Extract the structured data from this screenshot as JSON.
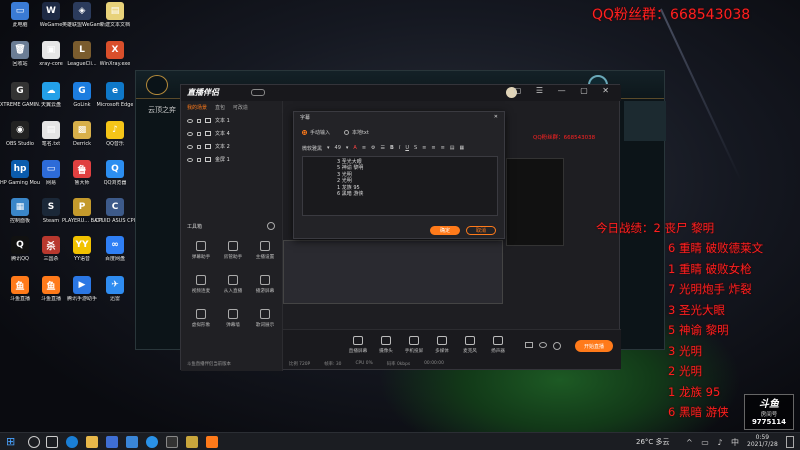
{
  "desktop_icons": [
    {
      "label": "此电脑",
      "color": "#3a7bd5",
      "glyph": "▭"
    },
    {
      "label": "WeGame",
      "color": "#1e2a44",
      "glyph": "W"
    },
    {
      "label": "英雄联盟WeGame版",
      "color": "#2b3b5c",
      "glyph": "◈"
    },
    {
      "label": "新建文本文档",
      "color": "#e8d27a",
      "glyph": "▤"
    },
    {
      "label": "回收站",
      "color": "#6b7d95",
      "glyph": "🗑"
    },
    {
      "label": "xray-core",
      "color": "#e6e6e6",
      "glyph": "▣"
    },
    {
      "label": "LeagueCli...",
      "color": "#7a5c2e",
      "glyph": "L"
    },
    {
      "label": "WinXray.exe",
      "color": "#d94f2b",
      "glyph": "X"
    },
    {
      "label": "XTREME GAMIN...",
      "color": "#333",
      "glyph": "G"
    },
    {
      "label": "天翼云盘",
      "color": "#23a0e8",
      "glyph": "☁"
    },
    {
      "label": "GoLink",
      "color": "#1c7de0",
      "glyph": "G"
    },
    {
      "label": "Microsoft Edge",
      "color": "#0f78c8",
      "glyph": "e"
    },
    {
      "label": "OBS Studio",
      "color": "#222",
      "glyph": "◉"
    },
    {
      "label": "笔名.txt",
      "color": "#e5e5e5",
      "glyph": "▤"
    },
    {
      "label": "Derrick",
      "color": "#d8b04a",
      "glyph": "▩"
    },
    {
      "label": "QQ音乐",
      "color": "#f5c518",
      "glyph": "♪"
    },
    {
      "label": "HP Gaming Mouse G...",
      "color": "#0b5cad",
      "glyph": "hp"
    },
    {
      "label": "网易",
      "color": "#2d6bd8",
      "glyph": "▭"
    },
    {
      "label": "鲁大师",
      "color": "#e04040",
      "glyph": "鲁"
    },
    {
      "label": "QQ浏览器",
      "color": "#2c8ef0",
      "glyph": "Q"
    },
    {
      "label": "控制面板",
      "color": "#3a86c8",
      "glyph": "▦"
    },
    {
      "label": "Steam",
      "color": "#1b2838",
      "glyph": "S"
    },
    {
      "label": "PLAYERU... BATTLEGR...",
      "color": "#c49a2c",
      "glyph": "P"
    },
    {
      "label": "CPUID ASUS CPU-Z",
      "color": "#3d5a8a",
      "glyph": "C"
    },
    {
      "label": "腾讯QQ",
      "color": "#111",
      "glyph": "Q"
    },
    {
      "label": "三国杀",
      "color": "#b8382e",
      "glyph": "杀"
    },
    {
      "label": "YY语音",
      "color": "#f2c200",
      "glyph": "YY"
    },
    {
      "label": "百度网盘",
      "color": "#2f7ff5",
      "glyph": "∞"
    },
    {
      "label": "斗鱼直播",
      "color": "#ff7a1a",
      "glyph": "鱼"
    },
    {
      "label": "斗鱼直播",
      "color": "#ff7a1a",
      "glyph": "鱼"
    },
    {
      "label": "腾讯手游助手",
      "color": "#2b77e4",
      "glyph": "▶"
    },
    {
      "label": "迅雷",
      "color": "#2f8cf0",
      "glyph": "✈"
    }
  ],
  "overlay": {
    "qq_group": "QQ粉丝群：668543038",
    "results_header": "今日战绩：2 丧尸 黎明",
    "results": [
      "6 重睛 破败德莱文",
      "1 重睛 破败女枪",
      "7 光明炮手 炸裂",
      "3 圣光大眼",
      "5 神谕 黎明",
      "3 光明",
      "2 光明",
      "1 龙族 95",
      "6 黑暗 游侠"
    ],
    "room_label": "房间号",
    "room_number": "9775114"
  },
  "lol_client": {
    "tab_label": "云顶之弈"
  },
  "bz": {
    "title": "直播伴侣",
    "tabs": [
      "我的场景",
      "直包",
      "可改造"
    ],
    "layers": [
      "文本 1",
      "文本 4",
      "文本 2",
      "金屏 1"
    ],
    "tools_title": "工具箱",
    "tools": [
      "弹幕助手",
      "房管助手",
      "主播设置",
      "视频连麦",
      "从入直播",
      "播游屏幕",
      "虚拟形象",
      "弹幕墙",
      "歌词展示"
    ],
    "bottom_tools": [
      "直播屏幕",
      "摄像头",
      "手机投屏",
      "多媒体",
      "麦克风",
      "扬声器"
    ],
    "start_button": "开始直播",
    "status_items": [
      "斗鱼直播伴侣当前版本",
      "比例 720P",
      "帧率: 30",
      "CPU 0%",
      "码率 0kbps",
      "00:00:00"
    ],
    "qq_overlay_text": "QQ粉丝群：668543038"
  },
  "dialog": {
    "title": "字幕",
    "radio1": "手动输入",
    "radio2": "本地txt",
    "font_name": "微软雅黑",
    "font_size": "49",
    "lines": [
      "3 圣光大眼",
      "5 神谕 黎明",
      "3 光明",
      "2 光明",
      "1 龙族 95",
      "6 黑暗 游侠"
    ],
    "ok": "确定",
    "cancel": "取消"
  },
  "taskbar": {
    "weather": "26°C 多云",
    "time": "0:59",
    "date": "2021/7/28"
  }
}
